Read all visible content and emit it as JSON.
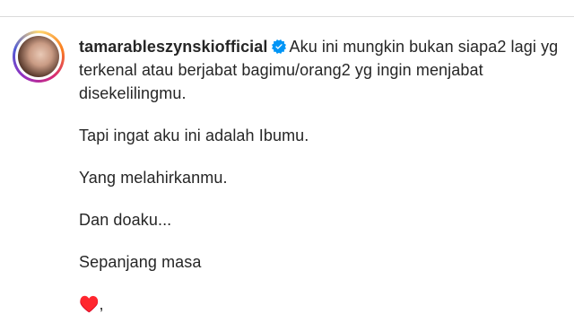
{
  "post": {
    "username": "tamarableszynskiofficial",
    "verified_icon": "verified-badge-icon",
    "caption_first": "Aku ini mungkin bukan siapa2 lagi yg terkenal atau berjabat bagimu/orang2 yg ingin menjabat disekelilingmu.",
    "caption_lines": [
      "Tapi ingat aku ini adalah Ibumu.",
      "Yang melahirkanmu.",
      "Dan doaku...",
      "Sepanjang masa"
    ],
    "last_line": "♥️,"
  },
  "colors": {
    "text": "#262626",
    "verified_blue": "#0095f6",
    "divider": "#dbdbdb"
  }
}
